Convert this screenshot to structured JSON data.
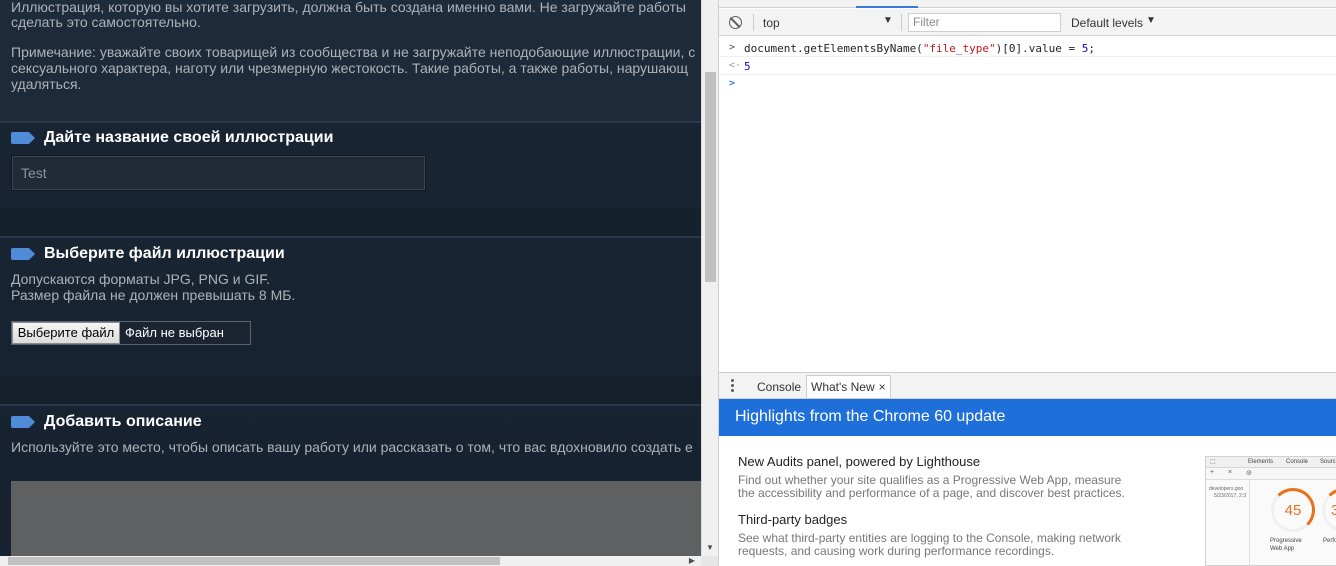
{
  "steam_form": {
    "intro_line1": "Иллюстрация, которую вы хотите загрузить, должна быть создана именно вами. Не загружайте работы",
    "intro_line2": "сделать это самостоятельно.",
    "note_line1": "Примечание: уважайте своих товарищей из сообщества и не загружайте неподобающие иллюстрации, с",
    "note_line2": "сексуального характера, наготу или чрезмерную жестокость. Такие работы, а также работы, нарушающ",
    "note_line3": "удаляться.",
    "title_section": "Дайте название своей иллюстрации",
    "title_value": "Test",
    "file_section": "Выберите файл иллюстрации",
    "formats_text": "Допускаются форматы JPG, PNG и GIF.",
    "size_text": "Размер файла не должен превышать 8 МБ.",
    "choose_file": "Выберите файл",
    "no_file": "Файл не выбран",
    "desc_section": "Добавить описание",
    "desc_hint": "Используйте это место, чтобы описать вашу работу или рассказать о том, что вас вдохновило создать е"
  },
  "devtools": {
    "context": "top",
    "filter_placeholder": "Filter",
    "levels": "Default levels",
    "console_lines": [
      {
        "type": "input",
        "code_prefix": "document.getElementsByName(",
        "code_string": "\"file_type\"",
        "code_suffix": ")[0].value = ",
        "code_number": "5",
        "code_end": ";"
      },
      {
        "type": "output",
        "value": "5"
      }
    ],
    "drawer": {
      "tab_console": "Console",
      "tab_whatsnew": "What's New",
      "close": "×"
    },
    "whats_new": {
      "title": "Highlights from the Chrome 60 update",
      "items": [
        {
          "title": "New Audits panel, powered by Lighthouse",
          "desc_line1": "Find out whether your site qualifies as a Progressive Web App, measure",
          "desc_line2": "the accessibility and performance of a page, and discover best practices."
        },
        {
          "title": "Third-party badges",
          "desc_line1": "See what third-party entities are logging to the Console, making network",
          "desc_line2": "requests, and causing work during performance recordings."
        }
      ],
      "thumbnail": {
        "tab_elements": "Elements",
        "tab_console": "Console",
        "tab_sources": "Sourc",
        "site": "developers.goo",
        "date": "5/23/2017, 2:3",
        "score1": "45",
        "score2": "3",
        "caption1_line1": "Progressive",
        "caption1_line2": "Web App",
        "caption2": "Perfo"
      }
    }
  },
  "colors": {
    "steam_bg": "#1b2838",
    "section_icon": "#4f8bd6",
    "devtools_blue": "#1f6fdb",
    "score_orange": "#e8711a"
  }
}
